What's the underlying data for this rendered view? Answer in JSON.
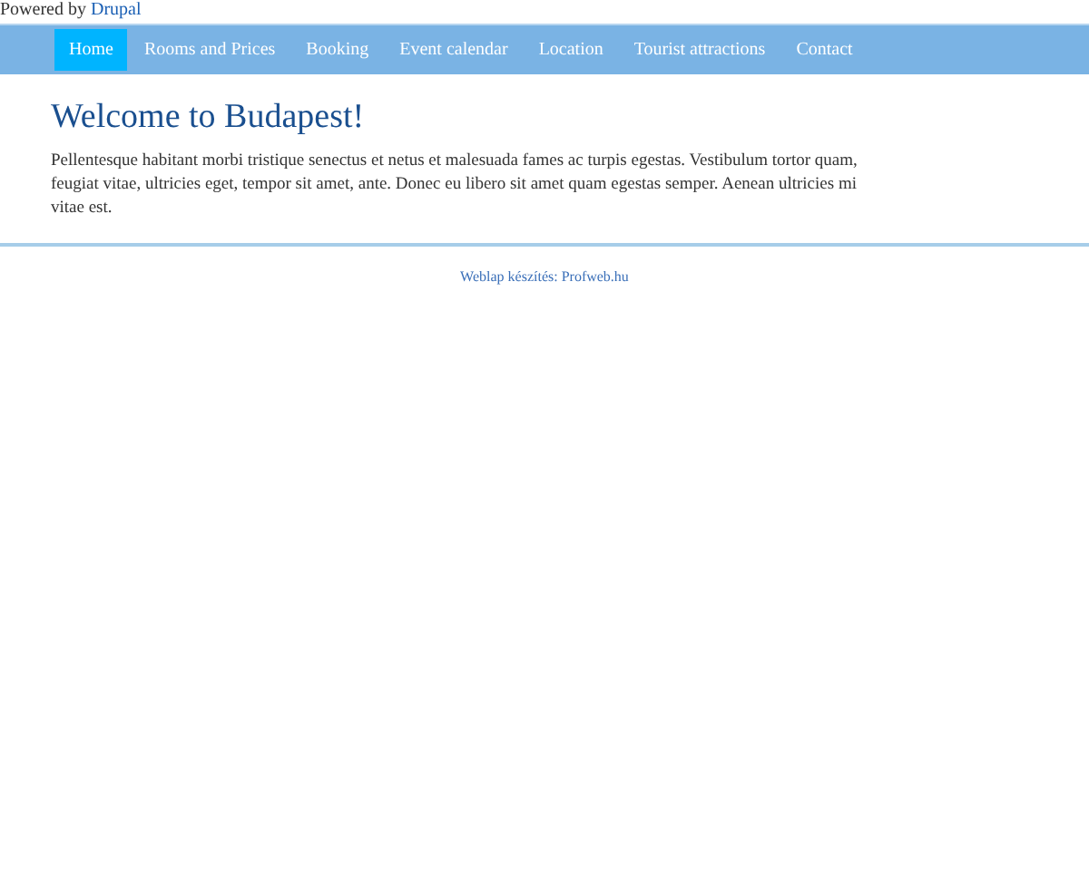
{
  "powered_by": {
    "text": "Powered by",
    "link": "Drupal"
  },
  "nav": [
    {
      "label": "Home",
      "selected": true
    },
    {
      "label": "Rooms and Prices",
      "selected": false
    },
    {
      "label": "Booking",
      "selected": false
    },
    {
      "label": "Event calendar",
      "selected": false
    },
    {
      "label": "Location",
      "selected": false
    },
    {
      "label": "Tourist attractions",
      "selected": false
    },
    {
      "label": "Contact",
      "selected": false
    }
  ],
  "content": {
    "title": "Welcome to Budapest!",
    "body": "Pellentesque habitant morbi tristique senectus et netus et malesuada fames ac turpis egestas. Vestibulum tortor quam, feugiat vitae, ultricies eget, tempor sit amet, ante. Donec eu libero sit amet quam egestas semper. Aenean ultricies mi vitae est."
  },
  "footer": {
    "text": "Weblap készítés:",
    "link": "Profweb.hu"
  }
}
